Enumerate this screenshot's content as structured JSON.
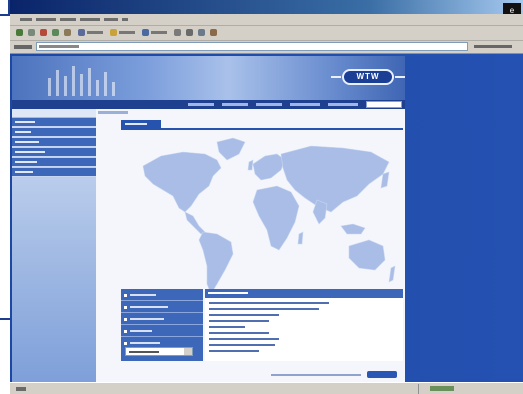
{
  "browser": {
    "title": "",
    "menu": [
      "",
      "",
      "",
      "",
      "",
      ""
    ],
    "toolbar": [
      "",
      "",
      "",
      "",
      "",
      "",
      "",
      ""
    ],
    "address_label": "",
    "address_value": "",
    "links_label": "",
    "status_text": "",
    "status_zone": ""
  },
  "site": {
    "logo": "WTW",
    "topnav": [
      "",
      "",
      "",
      "",
      ""
    ],
    "search_placeholder": "",
    "breadcrumb": "",
    "sidebar": {
      "heading": "",
      "items": [
        "",
        "",
        "",
        "",
        "",
        ""
      ]
    },
    "content_title": "",
    "contact": {
      "links": [
        "",
        "",
        "",
        "",
        ""
      ],
      "select_value": "",
      "heading": "",
      "address_lines": [
        "",
        "",
        "",
        "",
        "",
        "",
        "",
        "",
        ""
      ]
    },
    "footer_text": ""
  },
  "colors": {
    "site_blue": "#2553ad",
    "sidebar_item": "#3d67b8",
    "map_land": "#a9bde6",
    "page_background": "#1d47a5"
  }
}
